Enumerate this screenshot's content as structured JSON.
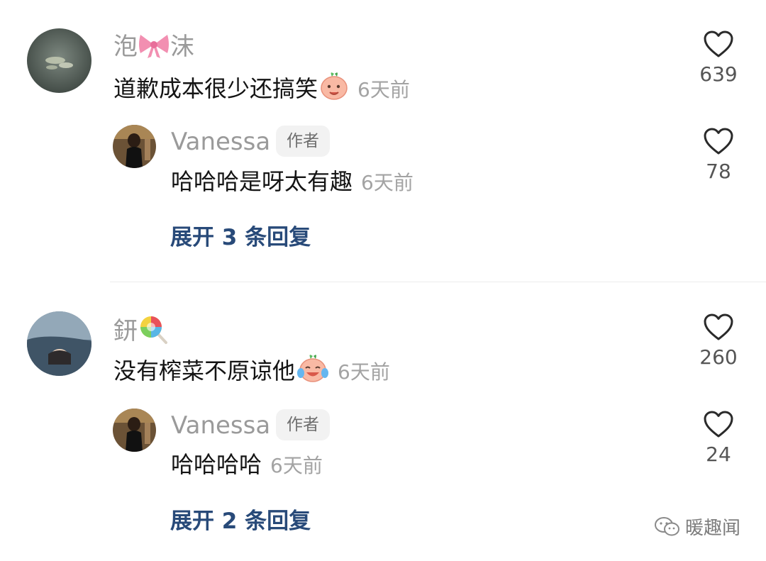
{
  "comments": [
    {
      "username": "泡🎀沫",
      "username_parts": [
        "泡",
        "沫"
      ],
      "text": "道歉成本很少还搞笑",
      "time": "6天前",
      "likes": "639",
      "reply": {
        "username": "Vanessa",
        "badge": "作者",
        "text": "哈哈哈是呀太有趣",
        "time": "6天前",
        "likes": "78"
      },
      "expand_label": "展开 3 条回复"
    },
    {
      "username": "鈃🍭",
      "username_parts": [
        "鈃"
      ],
      "text": "没有榨菜不原谅他",
      "time": "6天前",
      "likes": "260",
      "reply": {
        "username": "Vanessa",
        "badge": "作者",
        "text": "哈哈哈哈",
        "time": "6天前",
        "likes": "24"
      },
      "expand_label": "展开 2 条回复"
    }
  ],
  "watermark": {
    "text": "暖趣闻",
    "icon": "wechat-icon"
  },
  "icons": {
    "like": "heart-outline-icon"
  },
  "colors": {
    "username": "#9a9a9a",
    "expand": "#284a79",
    "time": "#a3a3a3"
  }
}
